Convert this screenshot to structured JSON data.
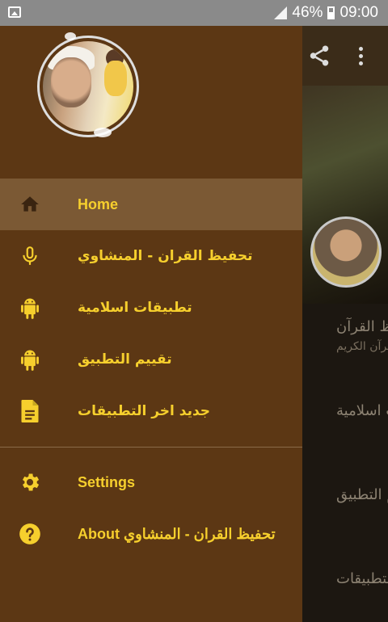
{
  "status_bar": {
    "battery": "46%",
    "time": "09:00"
  },
  "background_app": {
    "items": [
      {
        "title": "تحفيظ القرآن",
        "subtitle": "القرآن الكريم"
      },
      {
        "title": "تطبيقات اسلامية"
      },
      {
        "title": "تقييم التطبيق"
      },
      {
        "title": "جديد اخر التطبيقات"
      }
    ]
  },
  "drawer": {
    "items": [
      {
        "label": "Home",
        "icon": "home-icon",
        "active": true
      },
      {
        "label": "تحفيظ القران - المنشاوي",
        "icon": "microphone-icon"
      },
      {
        "label": "تطبيقات اسلامية",
        "icon": "android-icon"
      },
      {
        "label": "تقييم التطبيق",
        "icon": "android-icon"
      },
      {
        "label": "جديد اخر التطبيقات",
        "icon": "document-icon"
      }
    ],
    "secondary": [
      {
        "label": "Settings",
        "icon": "gear-icon"
      },
      {
        "label": "About تحفيظ القران - المنشاوي",
        "icon": "help-icon"
      }
    ]
  },
  "colors": {
    "drawer_bg": "#5c3714",
    "active_bg": "#7b5934",
    "accent": "#f6cf2d"
  }
}
